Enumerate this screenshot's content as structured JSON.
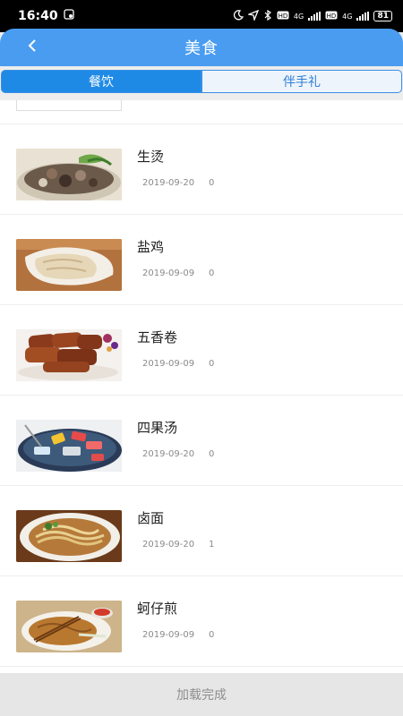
{
  "status_bar": {
    "time": "16:40",
    "network_1": "4G",
    "network_2": "4G",
    "battery": "81",
    "icons": [
      "sim-card-icon",
      "moon-icon",
      "location-icon",
      "bluetooth-icon",
      "hd-icon",
      "signal-icon",
      "wifi-icon",
      "battery-icon"
    ]
  },
  "header": {
    "title": "美食",
    "back_icon": "chevron-left-icon",
    "color": "#4a9cf0"
  },
  "tabs": [
    {
      "label": "餐饮",
      "active": true
    },
    {
      "label": "伴手礼",
      "active": false
    }
  ],
  "items": [
    {
      "title": "生烫",
      "date": "2019-09-20",
      "views": "0",
      "image": "soup-dish-image"
    },
    {
      "title": "盐鸡",
      "date": "2019-09-09",
      "views": "0",
      "image": "salt-chicken-image"
    },
    {
      "title": "五香卷",
      "date": "2019-09-09",
      "views": "0",
      "image": "five-spice-roll-image"
    },
    {
      "title": "四果汤",
      "date": "2019-09-20",
      "views": "0",
      "image": "fruit-dessert-soup-image"
    },
    {
      "title": "卤面",
      "date": "2019-09-20",
      "views": "1",
      "image": "braised-noodle-image"
    },
    {
      "title": "蚵仔煎",
      "date": "2019-09-09",
      "views": "0",
      "image": "oyster-omelette-image"
    }
  ],
  "footer": {
    "text": "加载完成"
  },
  "colors": {
    "accent": "#1f8ae6",
    "header": "#4a9cf0",
    "text_muted": "#8a8a8a"
  }
}
